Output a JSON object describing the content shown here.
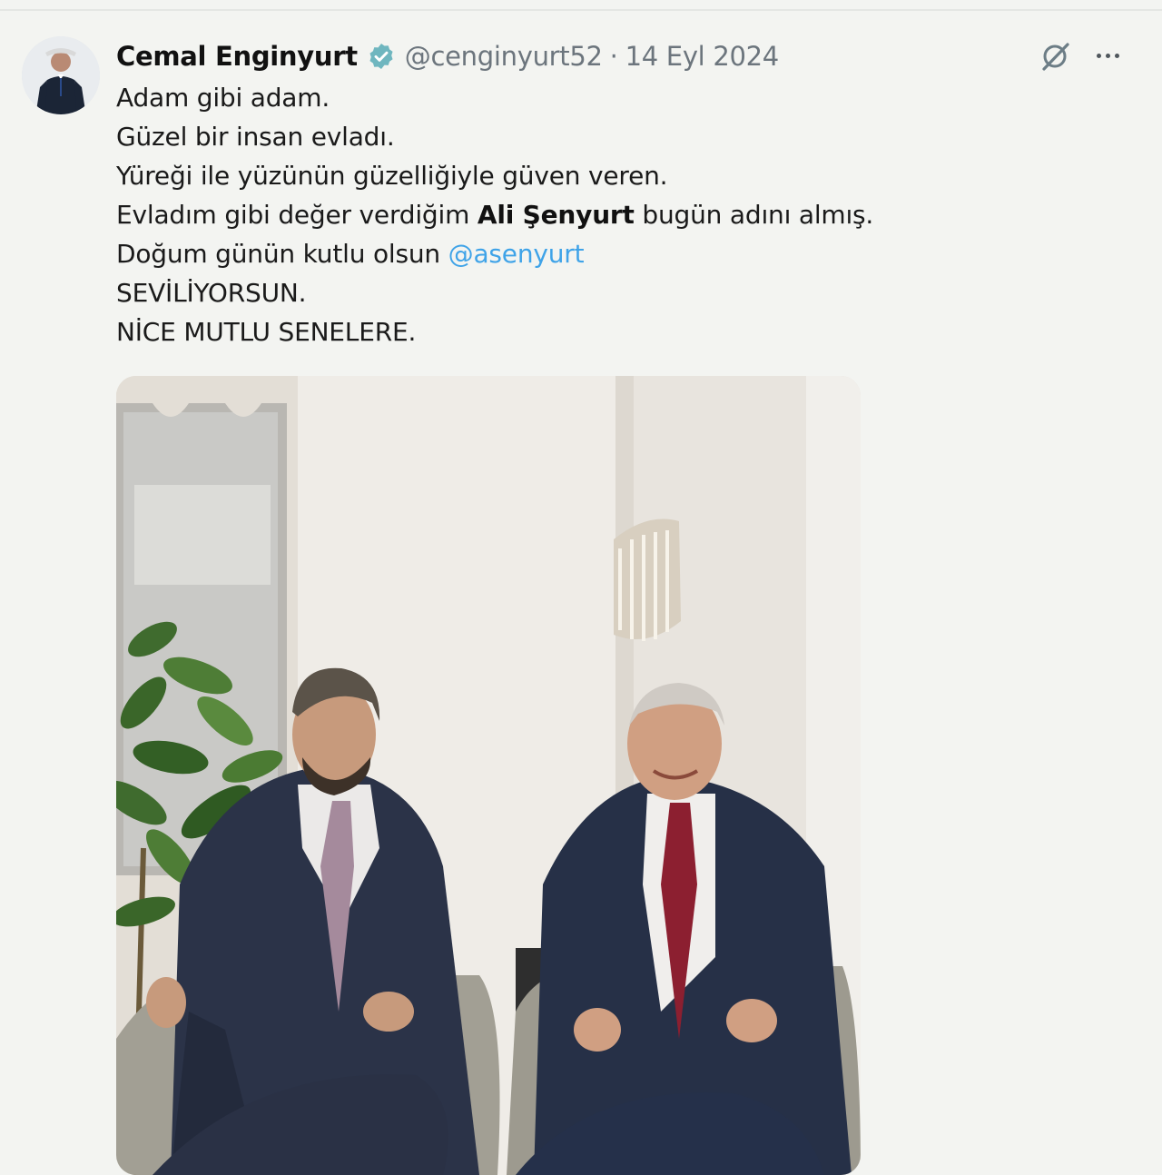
{
  "tweet": {
    "author_name": "Cemal Enginyurt",
    "handle": "@cenginyurt52",
    "separator": "·",
    "date": "14 Eyl 2024",
    "lines": [
      "Adam gibi adam.",
      "Güzel bir insan evladı.",
      "Yüreği ile yüzünün güzelliğiyle güven veren."
    ],
    "line4": {
      "before": "Evladım gibi değer verdiğim ",
      "bold": "Ali Şenyurt",
      "after": " bugün adını almış."
    },
    "line5": {
      "before": "Doğum günün kutlu olsun ",
      "mention": "@asenyurt"
    },
    "line6": "SEVİLİYORSUN.",
    "line7": "NİCE MUTLU SENELERE."
  },
  "icons": {
    "avatar": "avatar",
    "verified": "verified-badge-icon",
    "grok": "grok-icon",
    "more": "more-options-icon"
  },
  "colors": {
    "mention": "#3fa3e8",
    "verified_fill": "#6fb6bf",
    "muted_text": "#6c757d"
  }
}
